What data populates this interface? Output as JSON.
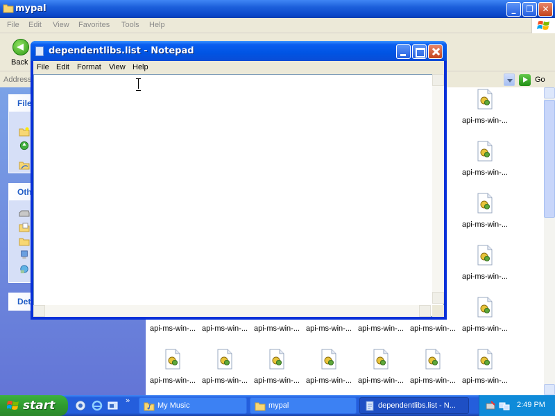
{
  "explorer": {
    "title": "mypal",
    "menu": [
      "File",
      "Edit",
      "View",
      "Favorites",
      "Tools",
      "Help"
    ],
    "toolbar": {
      "back_label": "Back"
    },
    "address": {
      "label": "Address",
      "go_label": "Go"
    },
    "taskpane": {
      "file_tasks_heading": "File",
      "other_places_heading": "Oth",
      "details_heading": "Det"
    },
    "files": [
      "api-ms-win-...",
      "api-ms-win-...",
      "api-ms-win-...",
      "api-ms-win-...",
      "api-ms-win-...",
      "api-ms-win-...",
      "api-ms-win-...",
      "api-ms-win-...",
      "api-ms-win-...",
      "api-ms-win-...",
      "api-ms-win-...",
      "api-ms-win-...",
      "api-ms-win-...",
      "api-ms-win-...",
      "api-ms-win-...",
      "api-ms-win-...",
      "api-ms-win-..."
    ]
  },
  "notepad": {
    "title": "dependentlibs.list - Notepad",
    "menu": [
      "File",
      "Edit",
      "Format",
      "View",
      "Help"
    ],
    "content": ""
  },
  "taskbar": {
    "start_label": "start",
    "tasks": [
      {
        "label": "My Music",
        "icon": "music-folder-icon",
        "active": false
      },
      {
        "label": "mypal",
        "icon": "folder-icon",
        "active": false
      },
      {
        "label": "dependentlibs.list - N...",
        "icon": "notepad-icon",
        "active": true
      }
    ],
    "clock": "2:49 PM"
  }
}
